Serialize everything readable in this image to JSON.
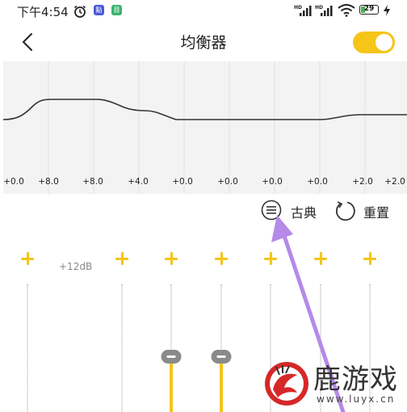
{
  "status_bar": {
    "time": "下午4:54",
    "icons": [
      "alarm-icon",
      "app-badge-icon",
      "app-badge-icon",
      "signal-hd-icon",
      "signal-hd-icon",
      "wifi-icon",
      "battery-icon",
      "charging-icon"
    ],
    "badge1_text": "點",
    "badge2_text": "目",
    "battery_level": "29",
    "battery_fraction": 0.29
  },
  "header": {
    "title": "均衡器",
    "toggle_on": true
  },
  "equalizer": {
    "gains": [
      "+0.0",
      "+8.0",
      "+8.0",
      "+4.0",
      "+0.0",
      "+0.0",
      "+0.0",
      "+0.0",
      "+2.0",
      "+2.0"
    ],
    "preset_label": "古典",
    "reset_label": "重置",
    "max_label": "+12dB"
  },
  "colors": {
    "accent": "#f5c518",
    "arrow": "#b58ae8",
    "panel_bg": "#f3f3f3"
  },
  "watermark": {
    "name": "鹿游戏",
    "url": "www.luyx.cn"
  }
}
